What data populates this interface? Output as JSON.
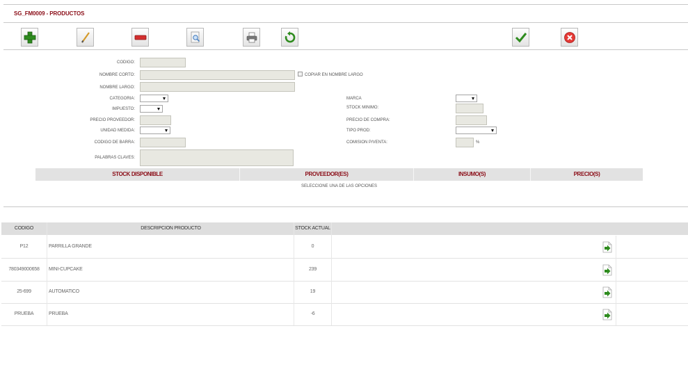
{
  "window": {
    "title": "SG_FM0009 - PRODUCTOS"
  },
  "toolbar": {
    "buttons": [
      {
        "name": "add-icon",
        "color": "#2e8b1e"
      },
      {
        "name": "pencil-icon",
        "color": "#d49a2a"
      },
      {
        "name": "minus-icon",
        "color": "#d32f2f"
      },
      {
        "name": "search-document-icon",
        "color": "#4a80c0"
      },
      {
        "name": "printer-icon",
        "color": "#666666"
      },
      {
        "name": "refresh-icon",
        "color": "#2e8b1e"
      },
      {
        "name": "check-icon",
        "color": "#2e8b1e"
      },
      {
        "name": "cancel-icon",
        "color": "#e53935"
      }
    ]
  },
  "form": {
    "codigo_label": "CODIGO:",
    "codigo_value": "",
    "nombre_corto_label": "NOMBRE CORTO:",
    "nombre_corto_value": "",
    "copiar_label": "COPIAR EN NOMBRE LARGO",
    "nombre_largo_label": "NOMBRE LARGO:",
    "nombre_largo_value": "",
    "categoria_label": "CATEGORIA:",
    "categoria_value": "",
    "impuesto_label": "IMPUESTO:",
    "impuesto_value": "",
    "precio_proveedor_label": "PRECIO PROVEEDOR:",
    "precio_proveedor_value": "",
    "unidad_medida_label": "UNIDAD MEDIDA:",
    "unidad_medida_value": "",
    "codigo_barra_label": "CODIGO DE BARRA:",
    "codigo_barra_value": "",
    "palabras_claves_label": "PALABRAS CLAVES:",
    "palabras_claves_value": "",
    "marca_label": "MARCA",
    "marca_value": "",
    "stock_minimo_label": "STOCK MINIMO:",
    "stock_minimo_value": "",
    "precio_compra_label": "PRECIO DE COMPRA:",
    "precio_compra_value": "",
    "tipo_prod_label": "TIPO PROD:",
    "tipo_prod_value": "",
    "comision_label": "COMISION P/VENTA:",
    "comision_value": "",
    "percent_label": "%"
  },
  "tabs": [
    {
      "label": "STOCK DISPONIBLE"
    },
    {
      "label": "PROVEEDOR(ES)"
    },
    {
      "label": "INSUMO(S)"
    },
    {
      "label": "PRECIO(S)"
    }
  ],
  "tabs_hint": "SELECCIONE UNA DE LAS OPCIONES",
  "table": {
    "columns": [
      "CODIGO",
      "DESCRIPCION PRODUCTO",
      "STOCK ACTUAL"
    ],
    "rows": [
      {
        "codigo": "P12",
        "descripcion": "PARRILLA GRANDE",
        "stock": "0"
      },
      {
        "codigo": "780349000658",
        "descripcion": "MINI-CUPCAKE",
        "stock": "239"
      },
      {
        "codigo": "25-699",
        "descripcion": "AUTOMATICO",
        "stock": "19"
      },
      {
        "codigo": "PRUEBA",
        "descripcion": "PRUEBA",
        "stock": "-6"
      }
    ],
    "row_action_icon": "go-arrow-icon"
  }
}
